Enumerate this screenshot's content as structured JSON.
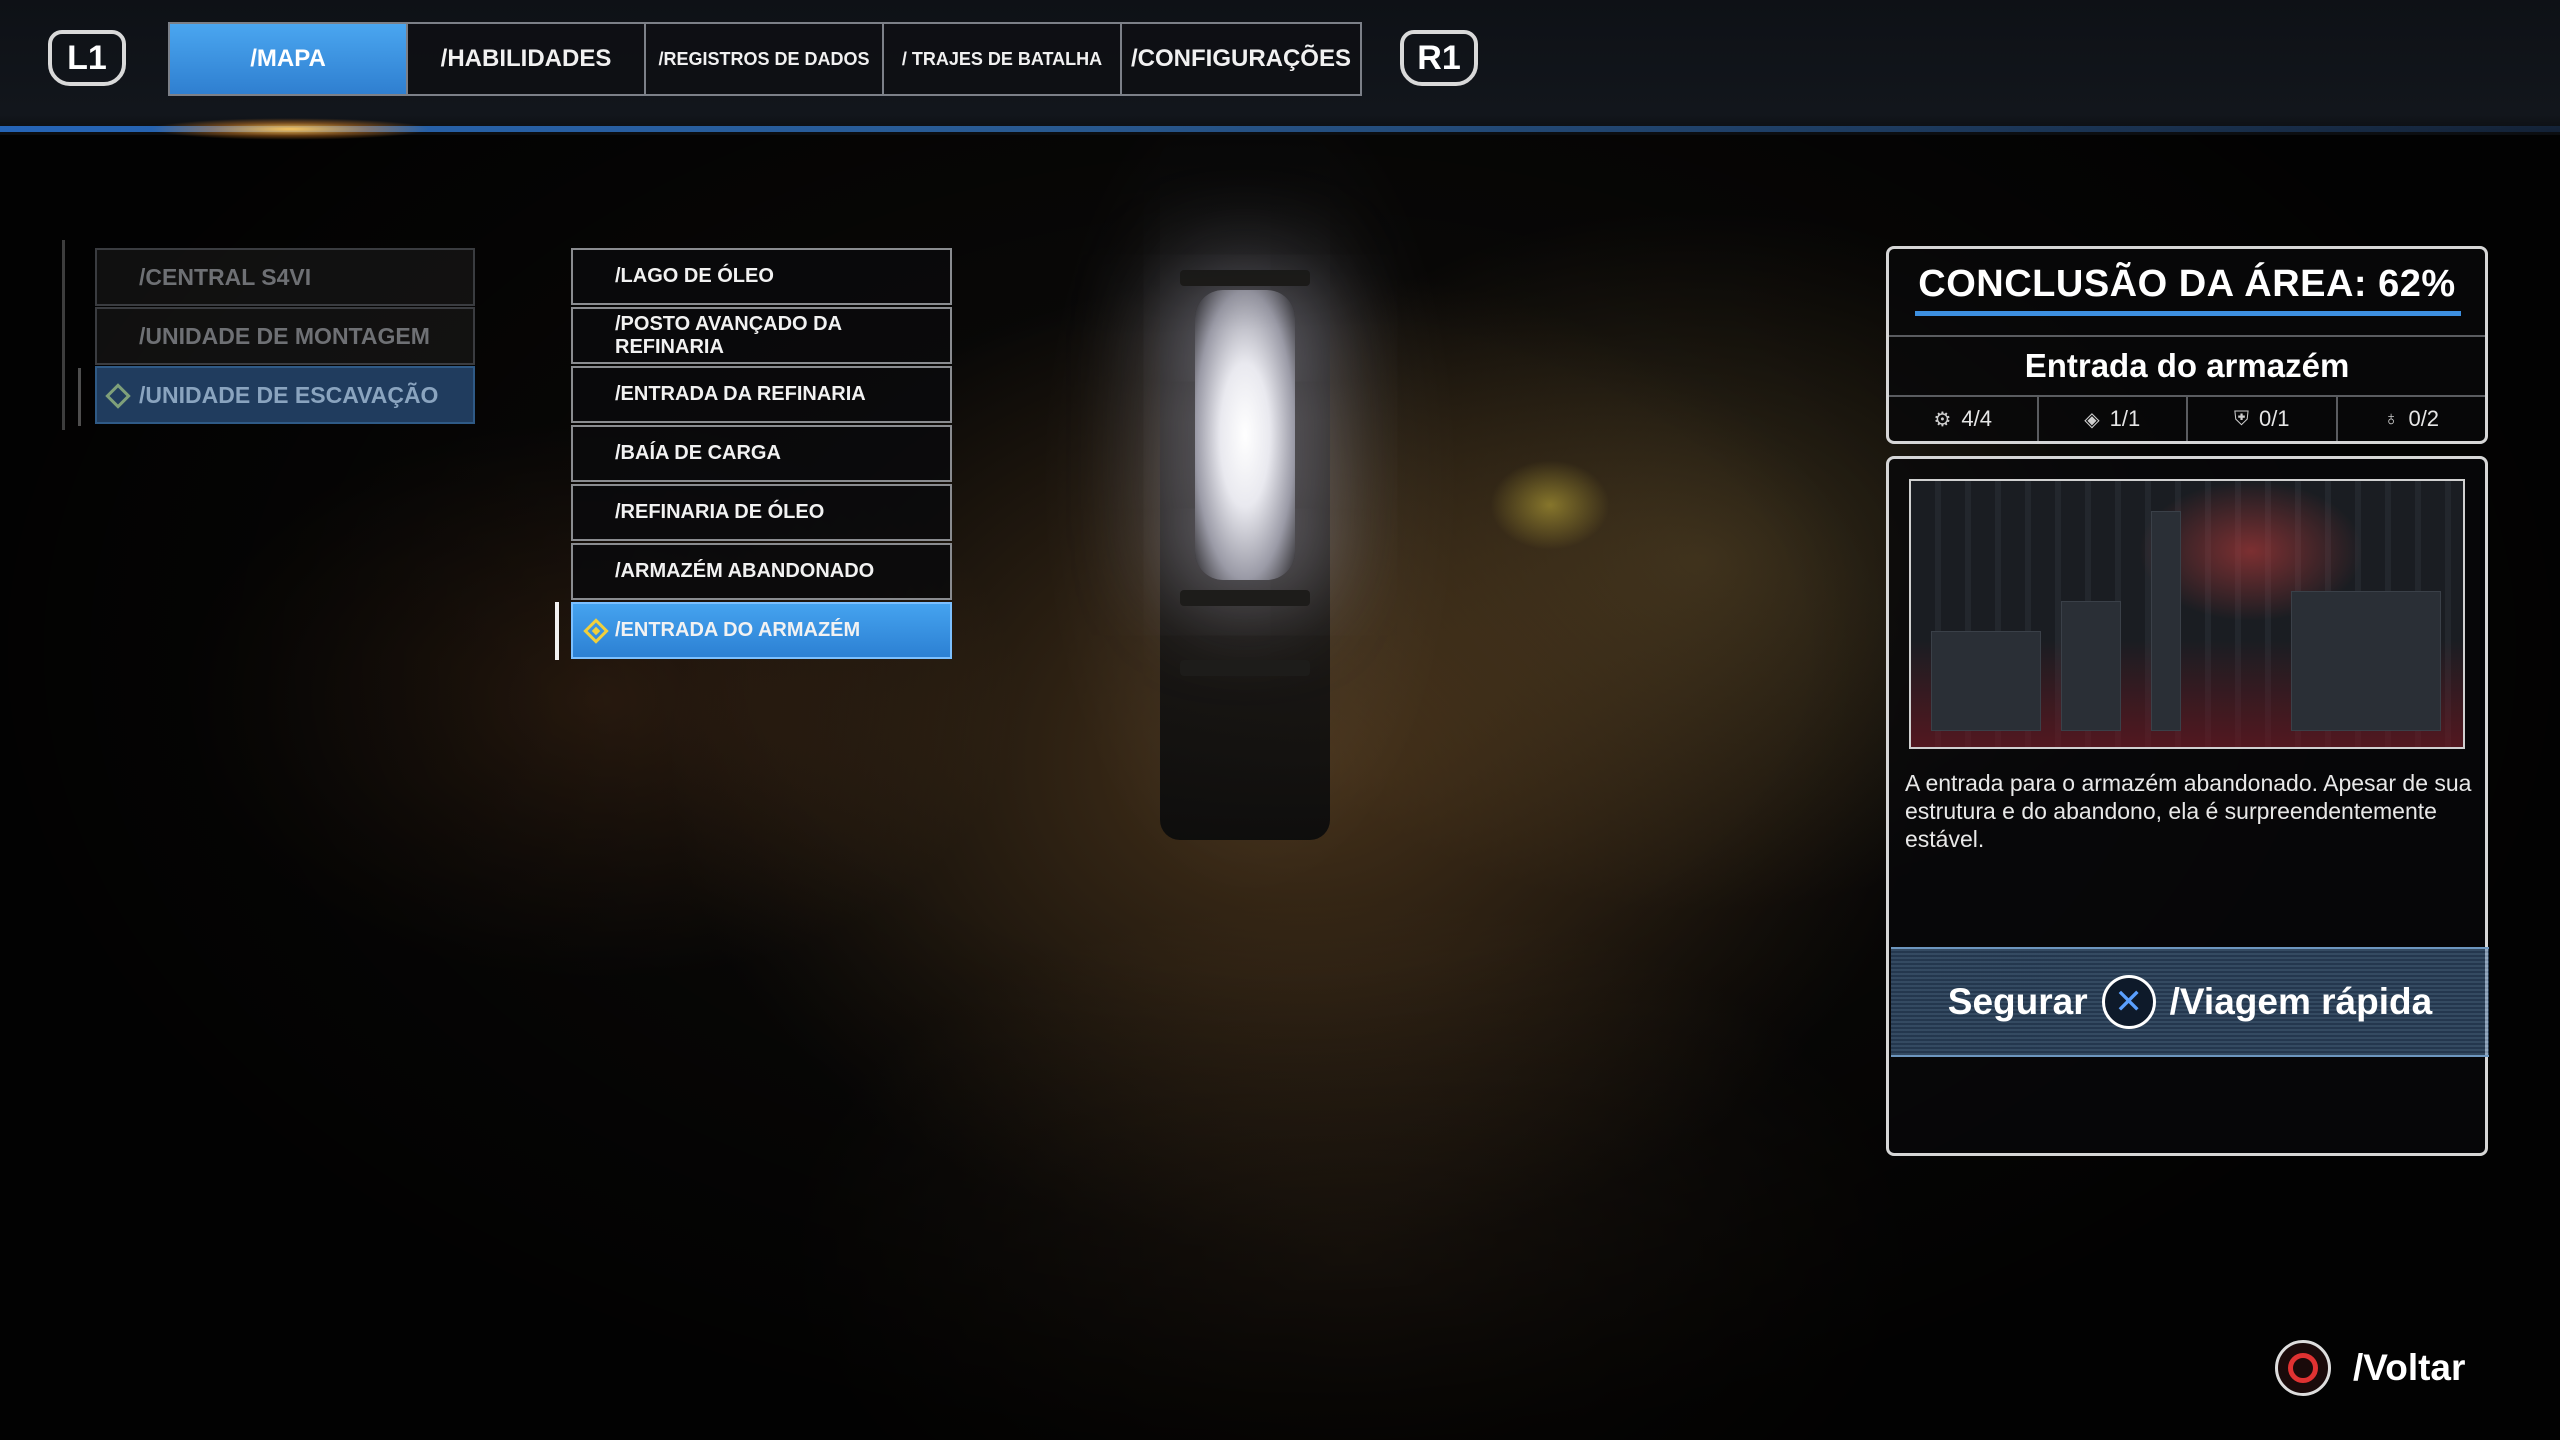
{
  "nav": {
    "left_shoulder": "L1",
    "right_shoulder": "R1",
    "tabs": [
      {
        "label": "/MAPA",
        "active": true
      },
      {
        "label": "/HABILIDADES",
        "active": false
      },
      {
        "label": "/REGISTROS DE DADOS",
        "active": false
      },
      {
        "label": "/ TRAJES DE BATALHA",
        "active": false
      },
      {
        "label": "/CONFIGURAÇÕES",
        "active": false
      }
    ]
  },
  "areas": [
    {
      "label": "/CENTRAL S4VI",
      "selected": false
    },
    {
      "label": "/UNIDADE DE MONTAGEM",
      "selected": false
    },
    {
      "label": "/UNIDADE DE ESCAVAÇÃO",
      "selected": true
    }
  ],
  "locations": [
    {
      "label": "/LAGO DE ÓLEO",
      "selected": false
    },
    {
      "label": "/POSTO AVANÇADO DA REFINARIA",
      "selected": false
    },
    {
      "label": "/ENTRADA DA REFINARIA",
      "selected": false
    },
    {
      "label": "/BAÍA DE CARGA",
      "selected": false
    },
    {
      "label": "/REFINARIA DE ÓLEO",
      "selected": false
    },
    {
      "label": "/ARMAZÉM ABANDONADO",
      "selected": false
    },
    {
      "label": "/ENTRADA DO ARMAZÉM",
      "selected": true
    }
  ],
  "panel": {
    "completion": "CONCLUSÃO DA ÁREA: 62%",
    "location_name": "Entrada do armazém",
    "stats": [
      {
        "icon": "gear-cog-icon",
        "value": "4/4"
      },
      {
        "icon": "meditation-point-icon",
        "value": "1/1"
      },
      {
        "icon": "chest-icon",
        "value": "0/1"
      },
      {
        "icon": "force-echo-icon",
        "value": "0/2"
      }
    ],
    "description": "A entrada para o armazém abandonado. Apesar de sua estrutura e do abandono, ela é surpreendentemente estável.",
    "fast_travel_hold": "Segurar",
    "fast_travel_button": "✕",
    "fast_travel_label": "/Viagem rápida"
  },
  "back_label": "/Voltar",
  "colors": {
    "accent_blue": "#3d8fe0",
    "active_tab": "#4aa6f0",
    "objective_yellow": "#f0cf3c",
    "back_red": "#e03232"
  }
}
